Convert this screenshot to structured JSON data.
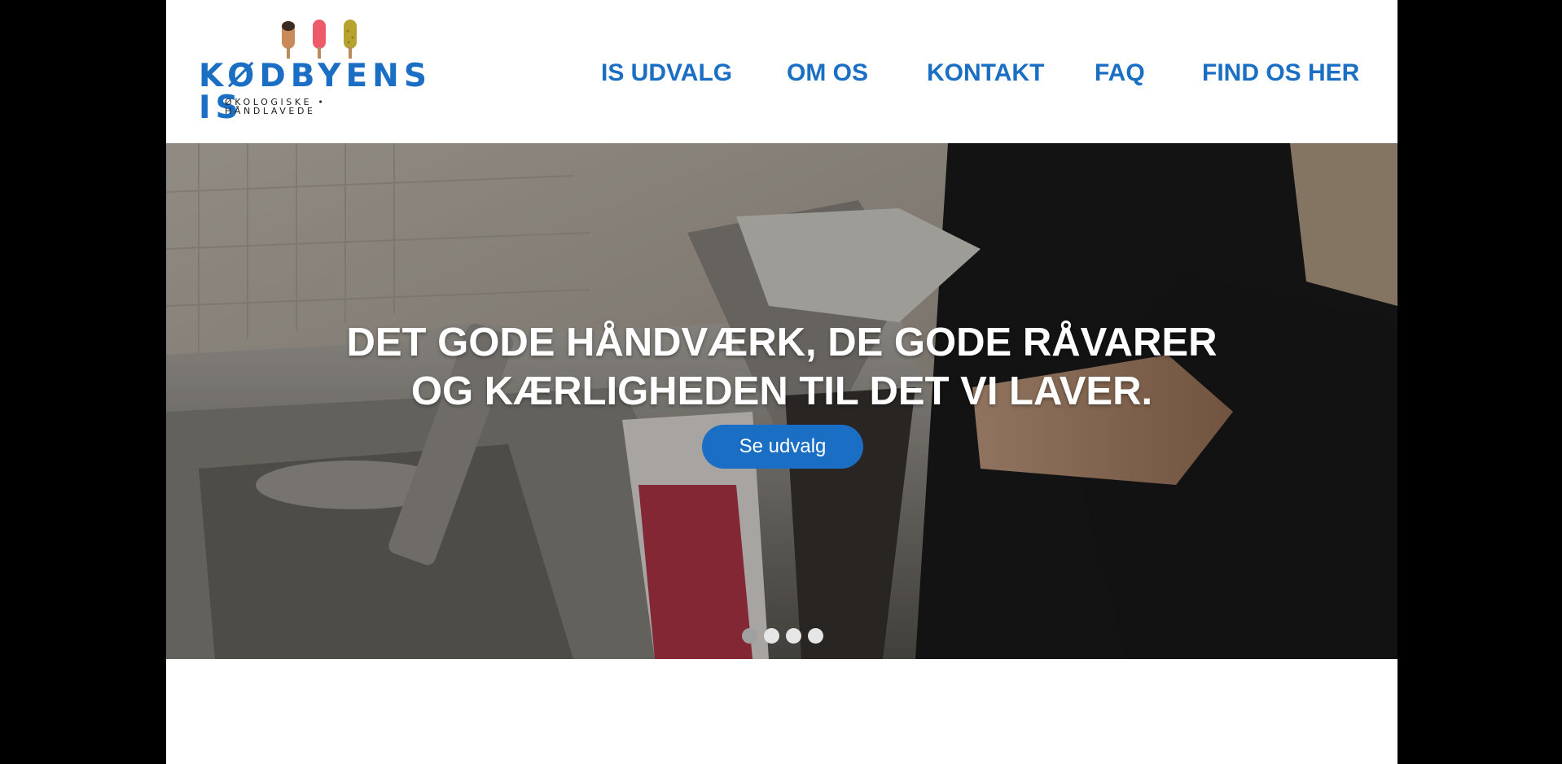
{
  "brand": {
    "name": "KØDBYENS IS",
    "tagline": "ØKOLOGISKE • HÅNDLAVEDE",
    "colors": {
      "primary": "#1a6ec4",
      "pop_brown": "#c98a5b",
      "pop_red": "#ef5a6a",
      "pop_olive": "#b7a12f"
    }
  },
  "nav": {
    "items": [
      {
        "label": "IS UDVALG"
      },
      {
        "label": "OM OS"
      },
      {
        "label": "KONTAKT"
      },
      {
        "label": "FAQ"
      },
      {
        "label": "FIND OS HER"
      }
    ]
  },
  "hero": {
    "headline_line1": "DET GODE HÅNDVÆRK, DE GODE RÅVARER",
    "headline_line2": "OG KÆRLIGHEDEN TIL DET VI LAVER.",
    "cta_label": "Se udvalg",
    "slides": {
      "count": 4,
      "active_index": 0
    }
  }
}
